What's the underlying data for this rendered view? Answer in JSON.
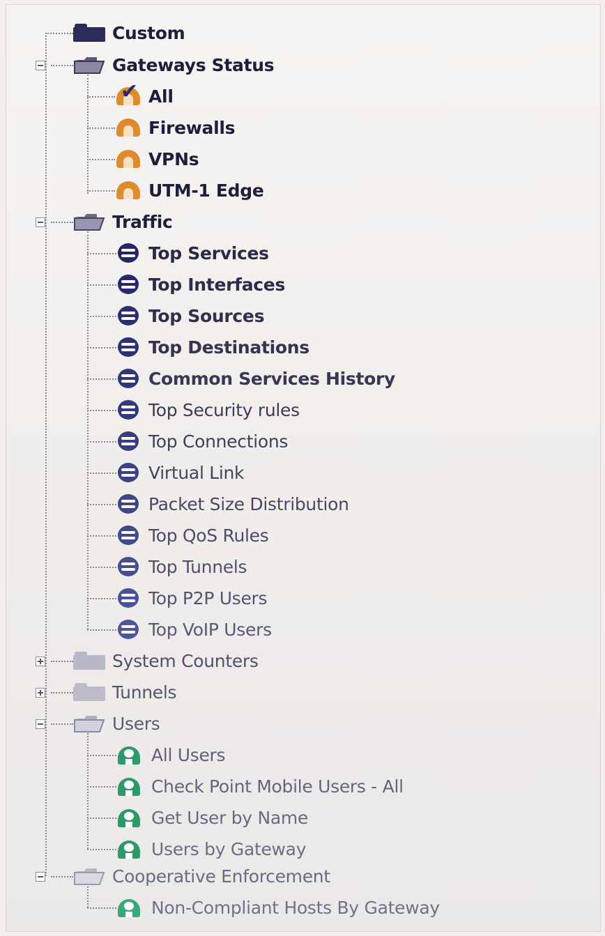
{
  "tree": {
    "custom": {
      "label": "Custom",
      "icon": "folder-icon"
    },
    "gateways_status": {
      "label": "Gateways Status",
      "icon": "folder-open-icon",
      "children": [
        {
          "label": "All",
          "icon": "gateway-check-icon"
        },
        {
          "label": "Firewalls",
          "icon": "gateway-icon"
        },
        {
          "label": "VPNs",
          "icon": "gateway-icon"
        },
        {
          "label": "UTM-1 Edge",
          "icon": "gateway-icon"
        }
      ]
    },
    "traffic": {
      "label": "Traffic",
      "icon": "folder-open-icon",
      "children": [
        {
          "label": "Top Services",
          "icon": "traffic-icon"
        },
        {
          "label": "Top Interfaces",
          "icon": "traffic-icon"
        },
        {
          "label": "Top Sources",
          "icon": "traffic-icon"
        },
        {
          "label": "Top Destinations",
          "icon": "traffic-icon"
        },
        {
          "label": "Common Services History",
          "icon": "traffic-icon"
        },
        {
          "label": "Top Security rules",
          "icon": "traffic-icon"
        },
        {
          "label": "Top Connections",
          "icon": "traffic-icon"
        },
        {
          "label": "Virtual Link",
          "icon": "traffic-icon"
        },
        {
          "label": "Packet Size Distribution",
          "icon": "traffic-icon"
        },
        {
          "label": "Top QoS Rules",
          "icon": "traffic-icon"
        },
        {
          "label": "Top Tunnels",
          "icon": "traffic-icon"
        },
        {
          "label": "Top P2P Users",
          "icon": "traffic-icon"
        },
        {
          "label": "Top VoIP Users",
          "icon": "traffic-icon"
        }
      ]
    },
    "system_counters": {
      "label": "System Counters",
      "icon": "folder-icon"
    },
    "tunnels": {
      "label": "Tunnels",
      "icon": "folder-icon"
    },
    "users": {
      "label": "Users",
      "icon": "folder-open-icon",
      "children": [
        {
          "label": "All Users",
          "icon": "user-icon"
        },
        {
          "label": "Check Point Mobile Users - All",
          "icon": "user-icon"
        },
        {
          "label": "Get User by Name",
          "icon": "user-icon"
        },
        {
          "label": "Users by Gateway",
          "icon": "user-icon"
        }
      ]
    },
    "cooperative_enforcement": {
      "label": "Cooperative Enforcement",
      "icon": "folder-open-icon",
      "children": [
        {
          "label": "Non-Compliant Hosts By Gateway",
          "icon": "user-icon"
        }
      ]
    }
  },
  "colors": {
    "folder_dark": "#2c2c5a",
    "folder_light": "#b9b8c8",
    "gateway_orange": "#e08a2e",
    "traffic_blue": "#2b2f78",
    "user_green": "#2e9a6a"
  }
}
